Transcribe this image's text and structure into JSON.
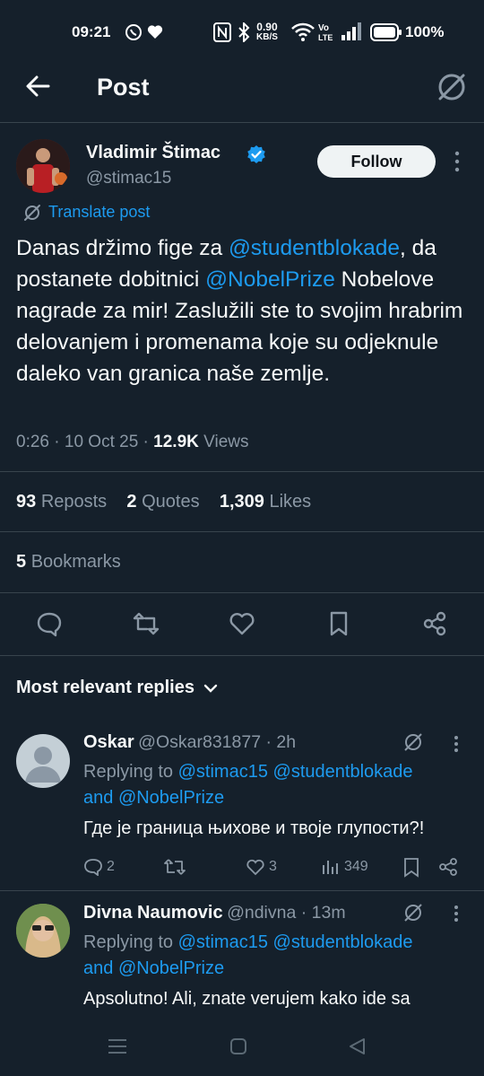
{
  "status_bar": {
    "time": "09:21",
    "speed_value": "0.90",
    "speed_unit": "KB/S",
    "battery": "100%"
  },
  "header": {
    "title": "Post"
  },
  "post": {
    "author_name": "Vladimir Štimac",
    "author_handle": "@stimac15",
    "follow_label": "Follow",
    "translate_label": "Translate post",
    "text_parts": {
      "p1": "Danas držimo fige za ",
      "m1": "@studentblokade",
      "p2": ", da postanete dobitnici ",
      "m2": "@NobelPrize",
      "p3": " Nobelove nagrade za mir! Zaslužili ste to svojim hrabrim delovanjem i promenama koje su odjeknule daleko van granica naše zemlje."
    },
    "time": "0:26",
    "date": "10 Oct 25",
    "views_count": "12.9K",
    "views_label": "Views",
    "reposts_count": "93",
    "reposts_label": "Reposts",
    "quotes_count": "2",
    "quotes_label": "Quotes",
    "likes_count": "1,309",
    "likes_label": "Likes",
    "bookmarks_count": "5",
    "bookmarks_label": "Bookmarks"
  },
  "replies_header": "Most relevant replies",
  "replies": [
    {
      "name": "Oskar",
      "handle": "@Oskar831877",
      "time": "2h",
      "replying_prefix": "Replying to ",
      "mention1": "@stimac15",
      "mention2": "@studentblokade",
      "and_word": "and ",
      "mention3": "@NobelPrize",
      "text": "Где је граница њихове и твоје глупости?!",
      "replies": "2",
      "likes": "3",
      "views": "349"
    },
    {
      "name": "Divna Naumovic",
      "handle": "@ndivna",
      "time": "13m",
      "replying_prefix": "Replying to ",
      "mention1": "@stimac15",
      "mention2": "@studentblokade",
      "and_word": "and ",
      "mention3": "@NobelPrize",
      "text": "Apsolutno! Ali, znate verujem kako ide sa"
    }
  ],
  "colors": {
    "background": "#15202b",
    "accent": "#1d9bf0",
    "muted": "#8b98a5",
    "divider": "#38444d"
  },
  "icons": [
    "back-arrow-icon",
    "grok-icon",
    "verified-badge-icon",
    "more-icon",
    "translate-icon",
    "reply-icon",
    "repost-icon",
    "like-icon",
    "bookmark-icon",
    "share-icon",
    "chevron-down-icon",
    "views-icon"
  ]
}
